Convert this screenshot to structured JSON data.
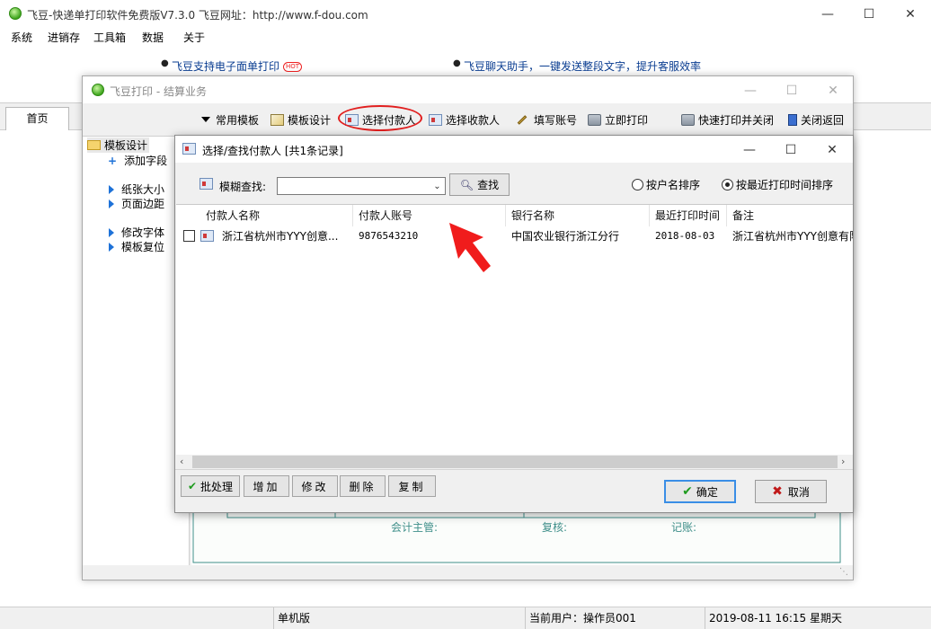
{
  "main_window": {
    "title": "飞豆-快递单打印软件免费版V7.3.0  飞豆网址：http://www.f-dou.com",
    "menu": [
      "系统",
      "进销存",
      "工具箱",
      "数据",
      "关于"
    ],
    "banner": {
      "link1": "飞豆支持电子面单打印",
      "hot_badge": "HOT",
      "link2": "飞豆聊天助手，一键发送整段文字，提升客服效率"
    },
    "tabs": {
      "home": "首页"
    },
    "statusbar": {
      "mode": "单机版",
      "user": "当前用户：操作员001",
      "datetime": "2019-08-11  16:15  星期天"
    }
  },
  "settle_window": {
    "title": "飞豆打印 - 结算业务",
    "toolbar": {
      "common_templates": "常用模板",
      "template_design": "模板设计",
      "select_payer": "选择付款人",
      "select_payee": "选择收款人",
      "fill_account": "填写账号",
      "print_now": "立即打印",
      "quick_print_close": "快速打印并关闭",
      "close_back": "关闭返回"
    },
    "tree": {
      "root": "模板设计",
      "add_field": "添加字段",
      "paper_size": "纸张大小",
      "page_margin": "页面边距",
      "change_font": "修改字体",
      "reset_template": "模板复位"
    },
    "form_preview": {
      "accountant": "会计主管:",
      "reviewer": "复核:",
      "bookkeeper": "记账:"
    }
  },
  "dialog": {
    "title": "选择/查找付款人  [共1条记录]",
    "search": {
      "label": "模糊查找:",
      "value": "",
      "button": "查找"
    },
    "sort_options": [
      {
        "label": "按户名排序",
        "selected": false
      },
      {
        "label": "按最近打印时间排序",
        "selected": true
      }
    ],
    "grid": {
      "columns": [
        "付款人名称",
        "付款人账号",
        "银行名称",
        "最近打印时间",
        "备注"
      ],
      "rows": [
        {
          "checked": false,
          "name": "浙江省杭州市YYY创意...",
          "account": "9876543210",
          "bank": "中国农业银行浙江分行",
          "last_print": "2018-08-03",
          "note": "浙江省杭州市YYY创意有限"
        }
      ]
    },
    "footer": {
      "batch": "批处理",
      "add": "增加",
      "edit": "修改",
      "delete": "删除",
      "copy": "复制",
      "ok": "确定",
      "cancel": "取消"
    }
  },
  "colors": {
    "annotation_red": "#e11f1f",
    "banner_link_blue": "#0a3d91",
    "primary_button_border": "#3a8ee6"
  }
}
